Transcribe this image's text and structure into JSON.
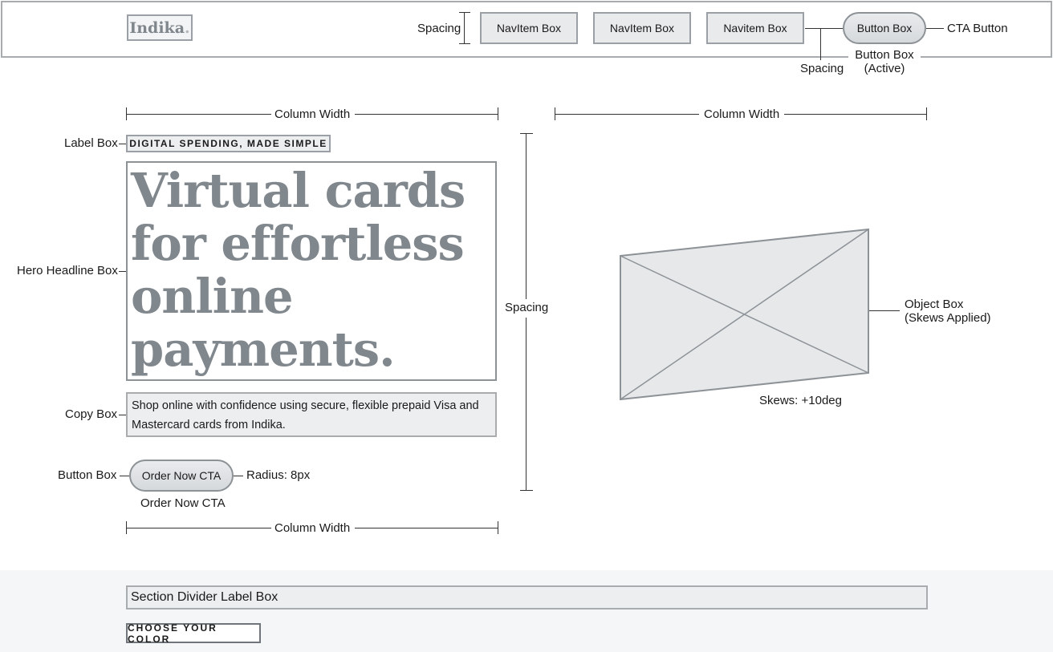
{
  "header": {
    "logo": "Indika",
    "logo_dot": ".",
    "nav_items": [
      "NavItem Box",
      "NavItem Box",
      "Navitem Box"
    ],
    "button_label": "Button Box",
    "annotations": {
      "spacing_left": "Spacing",
      "spacing_bottom": "Spacing",
      "cta_button": "CTA Button",
      "button_active_line1": "Button Box",
      "button_active_line2": "(Active)"
    }
  },
  "main": {
    "column_width_label": "Column Width",
    "label_box_annotation": "Label Box",
    "label_box_text": "DIGITAL SPENDING, MADE SIMPLE",
    "hero_annotation": "Hero Headline Box",
    "hero_headline": "Virtual cards\nfor effortless\nonline\npayments.",
    "copy_annotation": "Copy Box",
    "copy_text": "Shop online with confidence using secure, flexible prepaid Visa and Mastercard cards from Indika.",
    "button_annotation": "Button Box",
    "button_label": "Order Now CTA",
    "button_caption": "Order Now CTA",
    "radius_label": "Radius: 8px",
    "spacing_label": "Spacing",
    "object_annotation_line1": "Object Box",
    "object_annotation_line2": "(Skews Applied)",
    "skew_label": "Skews: +10deg"
  },
  "section": {
    "divider_label": "Section Divider Label Box",
    "choose_label": "CHOOSE YOUR COLOR"
  },
  "colors": {
    "box_border": "#9aa0a6",
    "box_fill": "#e8eaec",
    "headline_text": "#80878d",
    "line": "#333333"
  }
}
